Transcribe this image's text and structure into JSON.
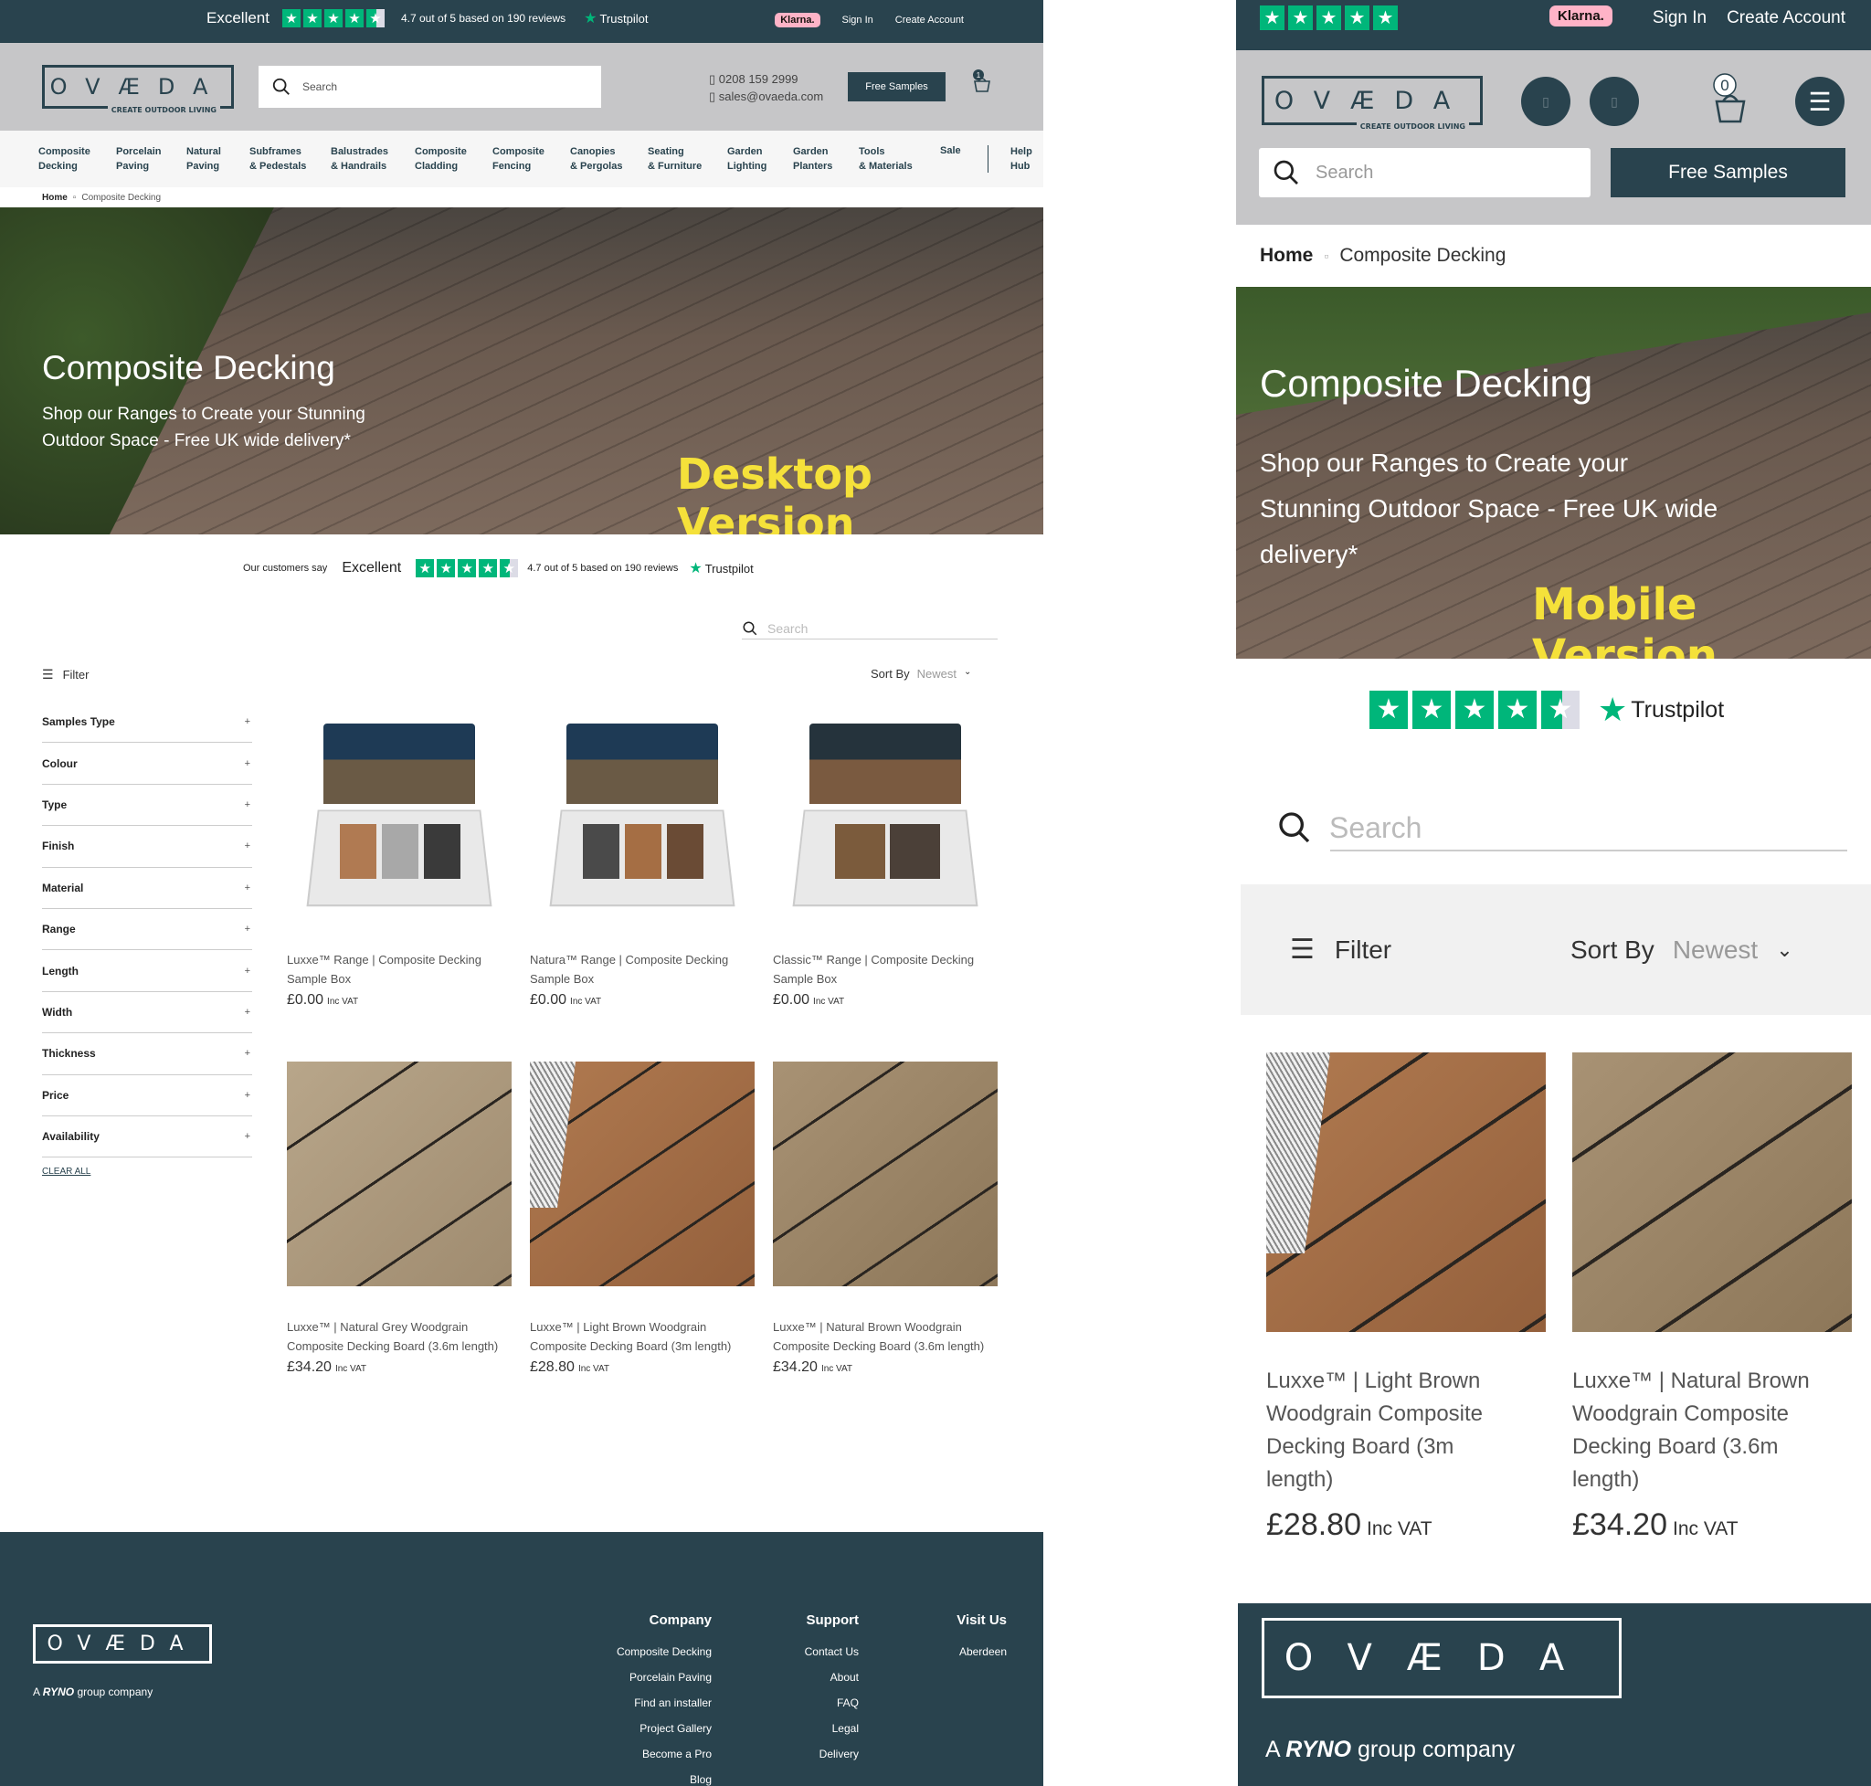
{
  "desktop": {
    "topbar": {
      "excellent": "Excellent",
      "rating_text": "4.7 out of 5 based on 190 reviews",
      "trustpilot": "Trustpilot",
      "klarna": "Klarna.",
      "sign_in": "Sign In",
      "create_account": "Create Account"
    },
    "header": {
      "logo": "OVÆDA",
      "logo_tagline": "CREATE OUTDOOR LIVING",
      "search_placeholder": "Search",
      "phone": "0208 159 2999",
      "email": "sales@ovaeda.com",
      "free_samples": "Free Samples",
      "basket_count": "1"
    },
    "nav": [
      {
        "l1": "Composite",
        "l2": "Decking"
      },
      {
        "l1": "Porcelain",
        "l2": "Paving"
      },
      {
        "l1": "Natural",
        "l2": "Paving"
      },
      {
        "l1": "Subframes",
        "l2": "& Pedestals"
      },
      {
        "l1": "Balustrades",
        "l2": "& Handrails"
      },
      {
        "l1": "Composite",
        "l2": "Cladding"
      },
      {
        "l1": "Composite",
        "l2": "Fencing"
      },
      {
        "l1": "Canopies",
        "l2": "& Pergolas"
      },
      {
        "l1": "Seating",
        "l2": "& Furniture"
      },
      {
        "l1": "Garden",
        "l2": "Lighting"
      },
      {
        "l1": "Garden",
        "l2": "Planters"
      },
      {
        "l1": "Tools",
        "l2": "& Materials"
      },
      {
        "l1": "Sale",
        "l2": ""
      },
      {
        "l1": "Help",
        "l2": "Hub"
      }
    ],
    "breadcrumb": {
      "home": "Home",
      "current": "Composite Decking"
    },
    "hero": {
      "title": "Composite Decking",
      "subtitle_1": "Shop our Ranges to Create your Stunning",
      "subtitle_2": "Outdoor Space - Free UK wide delivery*",
      "tag": "Desktop Version"
    },
    "trustbar": {
      "lead": "Our customers say",
      "excellent": "Excellent",
      "rating_text": "4.7 out of 5 based on 190 reviews",
      "trustpilot": "Trustpilot"
    },
    "search_placeholder": "Search",
    "filter_label": "Filter",
    "sort_label": "Sort By",
    "sort_value": "Newest",
    "facets": [
      "Samples Type",
      "Colour",
      "Type",
      "Finish",
      "Material",
      "Range",
      "Length",
      "Width",
      "Thickness",
      "Price",
      "Availability"
    ],
    "clear_all": "CLEAR ALL",
    "products": [
      {
        "name": "Luxxe™ Range | Composite Decking Sample Box",
        "price": "£0.00",
        "vat": "Inc VAT"
      },
      {
        "name": "Natura™ Range | Composite Decking Sample Box",
        "price": "£0.00",
        "vat": "Inc VAT"
      },
      {
        "name": "Classic™ Range | Composite Decking Sample Box",
        "price": "£0.00",
        "vat": "Inc VAT"
      },
      {
        "name": "Luxxe™ | Natural Grey Woodgrain Composite Decking Board (3.6m length)",
        "price": "£34.20",
        "vat": "Inc VAT"
      },
      {
        "name": "Luxxe™ | Light Brown Woodgrain Composite Decking Board (3m length)",
        "price": "£28.80",
        "vat": "Inc VAT"
      },
      {
        "name": "Luxxe™ | Natural Brown Woodgrain Composite Decking Board (3.6m length)",
        "price": "£34.20",
        "vat": "Inc VAT"
      }
    ],
    "footer": {
      "logo": "OVÆDA",
      "ryno_prefix": "A",
      "ryno_brand": "RYNO",
      "ryno_suffix": "group company",
      "company": {
        "heading": "Company",
        "links": [
          "Composite Decking",
          "Porcelain Paving",
          "Find an installer",
          "Project Gallery",
          "Become a Pro",
          "Blog"
        ]
      },
      "support": {
        "heading": "Support",
        "links": [
          "Contact Us",
          "About",
          "FAQ",
          "Legal",
          "Delivery"
        ]
      },
      "visit": {
        "heading": "Visit Us",
        "links": [
          "Aberdeen"
        ]
      }
    }
  },
  "mobile": {
    "topbar": {
      "klarna": "Klarna.",
      "sign_in": "Sign In",
      "create_account": "Create Account"
    },
    "header": {
      "logo": "OVÆDA",
      "logo_tagline": "CREATE OUTDOOR LIVING",
      "basket_count": "0",
      "search_placeholder": "Search",
      "free_samples": "Free Samples"
    },
    "breadcrumb": {
      "home": "Home",
      "current": "Composite Decking"
    },
    "hero": {
      "title": "Composite Decking",
      "subtitle_1": "Shop our Ranges to Create your",
      "subtitle_2": "Stunning Outdoor Space - Free UK wide",
      "subtitle_3": "delivery*",
      "tag": "Mobile Version"
    },
    "trustpilot": "Trustpilot",
    "search_placeholder": "Search",
    "filter_label": "Filter",
    "sort_label": "Sort By",
    "sort_value": "Newest",
    "products": [
      {
        "name_1": "Luxxe™ | Light Brown",
        "name_2": "Woodgrain Composite",
        "name_3": "Decking Board (3m",
        "name_4": "length)",
        "price": "£28.80",
        "vat": "Inc VAT"
      },
      {
        "name_1": "Luxxe™ | Natural Brown",
        "name_2": "Woodgrain Composite",
        "name_3": "Decking Board (3.6m",
        "name_4": "length)",
        "price": "£34.20",
        "vat": "Inc VAT"
      }
    ],
    "footer": {
      "logo": "OVÆDA",
      "ryno_prefix": "A",
      "ryno_brand": "RYNO",
      "ryno_suffix": "group company"
    }
  },
  "colors": {
    "brand": "#29434e",
    "trustpilot": "#00b67a",
    "klarna": "#ffb3c7",
    "version_tag": "#f5e13a"
  }
}
